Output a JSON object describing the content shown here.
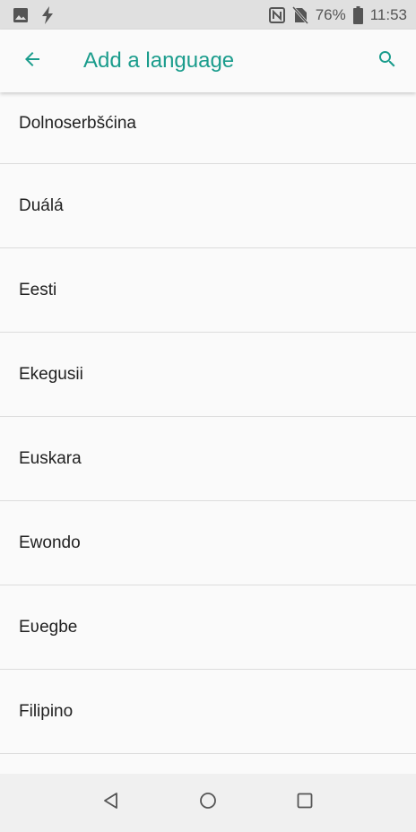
{
  "status_bar": {
    "battery": "76%",
    "time": "11:53"
  },
  "app_bar": {
    "title": "Add a language"
  },
  "languages": [
    {
      "label": "Dolnoserbšćina"
    },
    {
      "label": "Duálá"
    },
    {
      "label": "Eesti"
    },
    {
      "label": "Ekegusii"
    },
    {
      "label": "Euskara"
    },
    {
      "label": "Ewondo"
    },
    {
      "label": "Eʋegbe"
    },
    {
      "label": "Filipino"
    }
  ],
  "colors": {
    "accent": "#1a9c8c",
    "status_bar_bg": "#e0e0e0",
    "nav_bar_bg": "#f0f0f0"
  },
  "icons": {
    "status_left": [
      "image-icon",
      "flash-icon"
    ],
    "status_right": [
      "nfc-icon",
      "no-sim-icon",
      "battery-icon"
    ],
    "nav": [
      "back-triangle-icon",
      "home-circle-icon",
      "recents-square-icon"
    ]
  }
}
